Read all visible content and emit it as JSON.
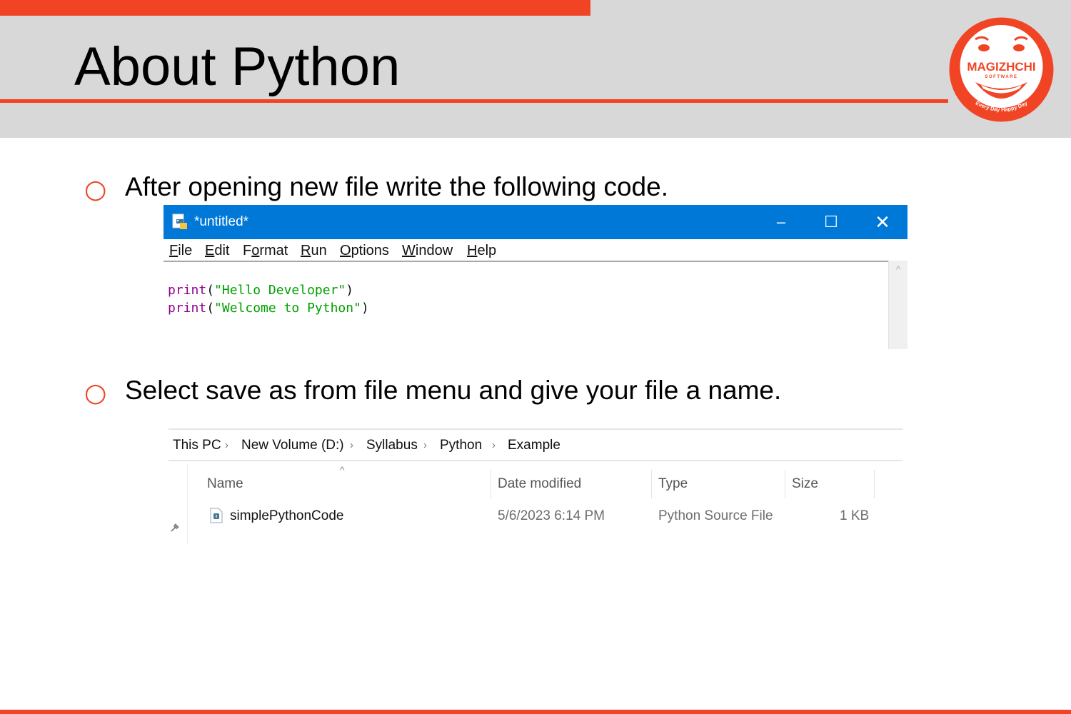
{
  "slide": {
    "title": "About Python",
    "bullets": [
      "After opening new file write the following code.",
      "Select save as from file menu and give your file a name."
    ],
    "bullet_marker": "○"
  },
  "logo": {
    "name": "MAGIZHCHI",
    "sub": "SOFTWARE",
    "tagline": "Every Day Happy Day"
  },
  "idle": {
    "title": "*untitled*",
    "menu": [
      {
        "u": "F",
        "rest": "ile"
      },
      {
        "u": "E",
        "rest": "dit"
      },
      {
        "pre": "F",
        "u": "o",
        "rest": "rmat"
      },
      {
        "u": "R",
        "rest": "un"
      },
      {
        "u": "O",
        "rest": "ptions"
      },
      {
        "u": "W",
        "rest": "indow"
      },
      {
        "u": "H",
        "rest": "elp"
      }
    ],
    "code": [
      {
        "fn": "print",
        "open": "(",
        "str": "\"Hello Developer\"",
        "close": ")"
      },
      {
        "fn": "print",
        "open": "(",
        "str": "\"Welcome to Python\"",
        "close": ")"
      }
    ],
    "colors": {
      "titlebar": "#0078d7",
      "keyword": "#900090",
      "string": "#00a000"
    }
  },
  "explorer": {
    "breadcrumb": [
      "This PC",
      "New Volume (D:)",
      "Syllabus",
      "Python",
      "Example"
    ],
    "columns": [
      "Name",
      "Date modified",
      "Type",
      "Size"
    ],
    "rows": [
      {
        "name": "simplePythonCode",
        "date": "5/6/2023 6:14 PM",
        "type": "Python Source File",
        "size": "1 KB"
      }
    ]
  },
  "colors": {
    "accent": "#f04424",
    "band": "#d8d8d8"
  }
}
